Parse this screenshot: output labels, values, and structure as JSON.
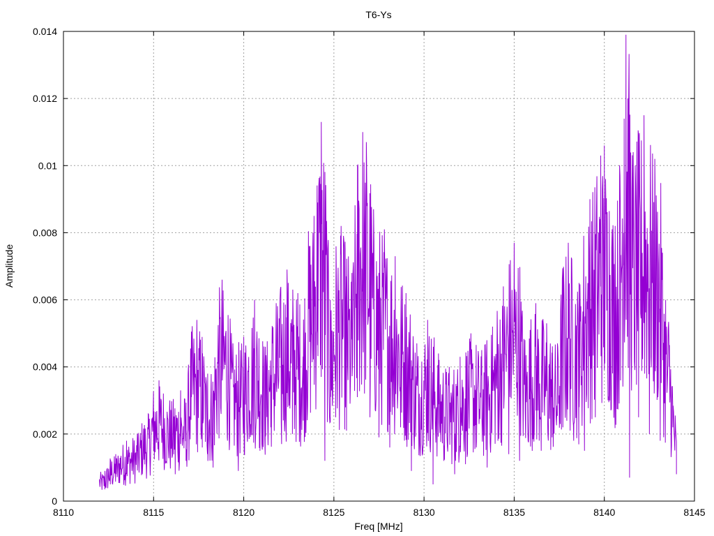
{
  "chart_data": {
    "type": "line",
    "title": "T6-Ys",
    "xlabel": "Freq [MHz]",
    "ylabel": "Amplitude",
    "xlim": [
      8110,
      8145
    ],
    "ylim": [
      0,
      0.014
    ],
    "x_ticks": [
      "8110",
      "8115",
      "8120",
      "8125",
      "8130",
      "8135",
      "8140",
      "8145"
    ],
    "y_ticks": [
      "0",
      "0.002",
      "0.004",
      "0.006",
      "0.008",
      "0.01",
      "0.012",
      "0.014"
    ],
    "grid": true,
    "series": [
      {
        "color": "#9400d3",
        "x_start": 8112,
        "x_end": 8144,
        "points": [
          [
            8112.0,
            0.0006
          ],
          [
            8112.3,
            0.0009
          ],
          [
            8112.6,
            0.0005
          ],
          [
            8112.9,
            0.0014
          ],
          [
            8113.2,
            0.0008
          ],
          [
            8113.5,
            0.0018
          ],
          [
            8113.8,
            0.0009
          ],
          [
            8114.1,
            0.002
          ],
          [
            8114.4,
            0.0011
          ],
          [
            8114.7,
            0.0026
          ],
          [
            8115.0,
            0.0015
          ],
          [
            8115.3,
            0.0036
          ],
          [
            8115.6,
            0.001
          ],
          [
            8115.9,
            0.003
          ],
          [
            8116.2,
            0.0008
          ],
          [
            8116.5,
            0.0033
          ],
          [
            8116.8,
            0.0012
          ],
          [
            8117.1,
            0.0031
          ],
          [
            8117.4,
            0.0054
          ],
          [
            8117.7,
            0.0016
          ],
          [
            8118.0,
            0.0038
          ],
          [
            8118.3,
            0.001
          ],
          [
            8118.6,
            0.0044
          ],
          [
            8118.8,
            0.0066
          ],
          [
            8119.1,
            0.0018
          ],
          [
            8119.4,
            0.0047
          ],
          [
            8119.7,
            0.0009
          ],
          [
            8120.0,
            0.0049
          ],
          [
            8120.3,
            0.0021
          ],
          [
            8120.6,
            0.006
          ],
          [
            8120.9,
            0.0015
          ],
          [
            8121.2,
            0.0046
          ],
          [
            8121.5,
            0.0022
          ],
          [
            8121.8,
            0.0059
          ],
          [
            8122.1,
            0.0017
          ],
          [
            8122.4,
            0.0069
          ],
          [
            8122.7,
            0.002
          ],
          [
            8123.0,
            0.0062
          ],
          [
            8123.3,
            0.0024
          ],
          [
            8123.6,
            0.0065
          ],
          [
            8123.9,
            0.0085
          ],
          [
            8124.1,
            0.0089
          ],
          [
            8124.3,
            0.0113
          ],
          [
            8124.5,
            0.0012
          ],
          [
            8124.8,
            0.006
          ],
          [
            8125.1,
            0.0025
          ],
          [
            8125.4,
            0.0082
          ],
          [
            8125.7,
            0.0021
          ],
          [
            8126.0,
            0.0068
          ],
          [
            8126.3,
            0.0031
          ],
          [
            8126.6,
            0.011
          ],
          [
            8126.8,
            0.0107
          ],
          [
            8127.0,
            0.0025
          ],
          [
            8127.2,
            0.0087
          ],
          [
            8127.5,
            0.0019
          ],
          [
            8127.8,
            0.0081
          ],
          [
            8128.1,
            0.0016
          ],
          [
            8128.4,
            0.0073
          ],
          [
            8128.7,
            0.0022
          ],
          [
            8129.0,
            0.0062
          ],
          [
            8129.3,
            0.0009
          ],
          [
            8129.6,
            0.0047
          ],
          [
            8129.9,
            0.0014
          ],
          [
            8130.2,
            0.0054
          ],
          [
            8130.5,
            0.0005
          ],
          [
            8130.8,
            0.0044
          ],
          [
            8131.1,
            0.0012
          ],
          [
            8131.4,
            0.004
          ],
          [
            8131.7,
            0.0008
          ],
          [
            8132.0,
            0.0043
          ],
          [
            8132.3,
            0.0011
          ],
          [
            8132.6,
            0.005
          ],
          [
            8132.9,
            0.0016
          ],
          [
            8133.2,
            0.0045
          ],
          [
            8133.5,
            0.001
          ],
          [
            8133.8,
            0.0052
          ],
          [
            8134.1,
            0.0018
          ],
          [
            8134.4,
            0.0064
          ],
          [
            8134.7,
            0.0014
          ],
          [
            8135.0,
            0.0077
          ],
          [
            8135.3,
            0.0012
          ],
          [
            8135.6,
            0.0048
          ],
          [
            8135.9,
            0.002
          ],
          [
            8136.2,
            0.0059
          ],
          [
            8136.5,
            0.0015
          ],
          [
            8136.8,
            0.0053
          ],
          [
            8137.1,
            0.0019
          ],
          [
            8137.4,
            0.0047
          ],
          [
            8137.7,
            0.0022
          ],
          [
            8138.0,
            0.0077
          ],
          [
            8138.3,
            0.0018
          ],
          [
            8138.6,
            0.0065
          ],
          [
            8138.9,
            0.0015
          ],
          [
            8139.2,
            0.009
          ],
          [
            8139.5,
            0.0025
          ],
          [
            8139.8,
            0.0103
          ],
          [
            8140.0,
            0.0106
          ],
          [
            8140.3,
            0.003
          ],
          [
            8140.6,
            0.0082
          ],
          [
            8140.9,
            0.0036
          ],
          [
            8141.1,
            0.0114
          ],
          [
            8141.2,
            0.0139
          ],
          [
            8141.4,
            0.0007
          ],
          [
            8141.6,
            0.0104
          ],
          [
            8141.9,
            0.0025
          ],
          [
            8142.2,
            0.0115
          ],
          [
            8142.5,
            0.002
          ],
          [
            8142.8,
            0.0102
          ],
          [
            8143.1,
            0.0018
          ],
          [
            8143.4,
            0.006
          ],
          [
            8143.6,
            0.004
          ],
          [
            8143.8,
            0.0022
          ],
          [
            8144.0,
            0.0008
          ]
        ]
      }
    ]
  }
}
